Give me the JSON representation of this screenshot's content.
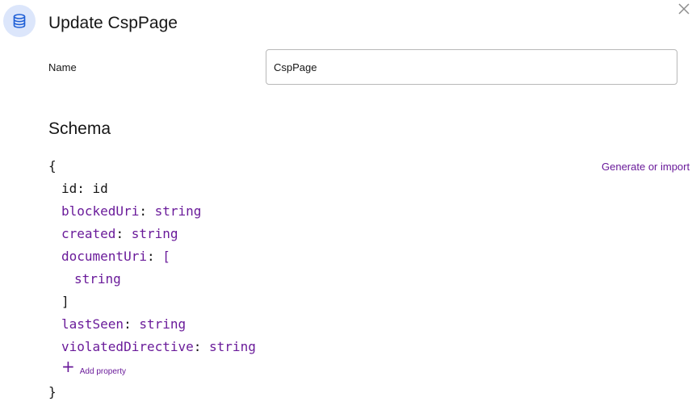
{
  "header": {
    "icon": "database-icon",
    "title": "Update CspPage",
    "close_icon": "close-icon"
  },
  "form": {
    "name_label": "Name",
    "name_value": "CspPage"
  },
  "schema": {
    "heading": "Schema",
    "generate_link": "Generate or import",
    "open_brace": "{",
    "close_brace": "}",
    "fields": [
      {
        "key": "id",
        "sep": ": ",
        "value": "id"
      },
      {
        "key": "blockedUri",
        "sep": ": ",
        "value": "string"
      },
      {
        "key": "created",
        "sep": ": ",
        "value": "string"
      },
      {
        "key": "documentUri",
        "sep": ": ",
        "value": "["
      },
      {
        "key": "lastSeen",
        "sep": ": ",
        "value": "string"
      },
      {
        "key": "violatedDirective",
        "sep": ": ",
        "value": "string"
      }
    ],
    "array_item": "string",
    "array_close": "]",
    "add_plus": "+",
    "add_property": "Add property"
  },
  "colors": {
    "accent": "#6a1b9a",
    "icon_bg": "#dce6fb",
    "icon_fg": "#1f5fd6"
  }
}
